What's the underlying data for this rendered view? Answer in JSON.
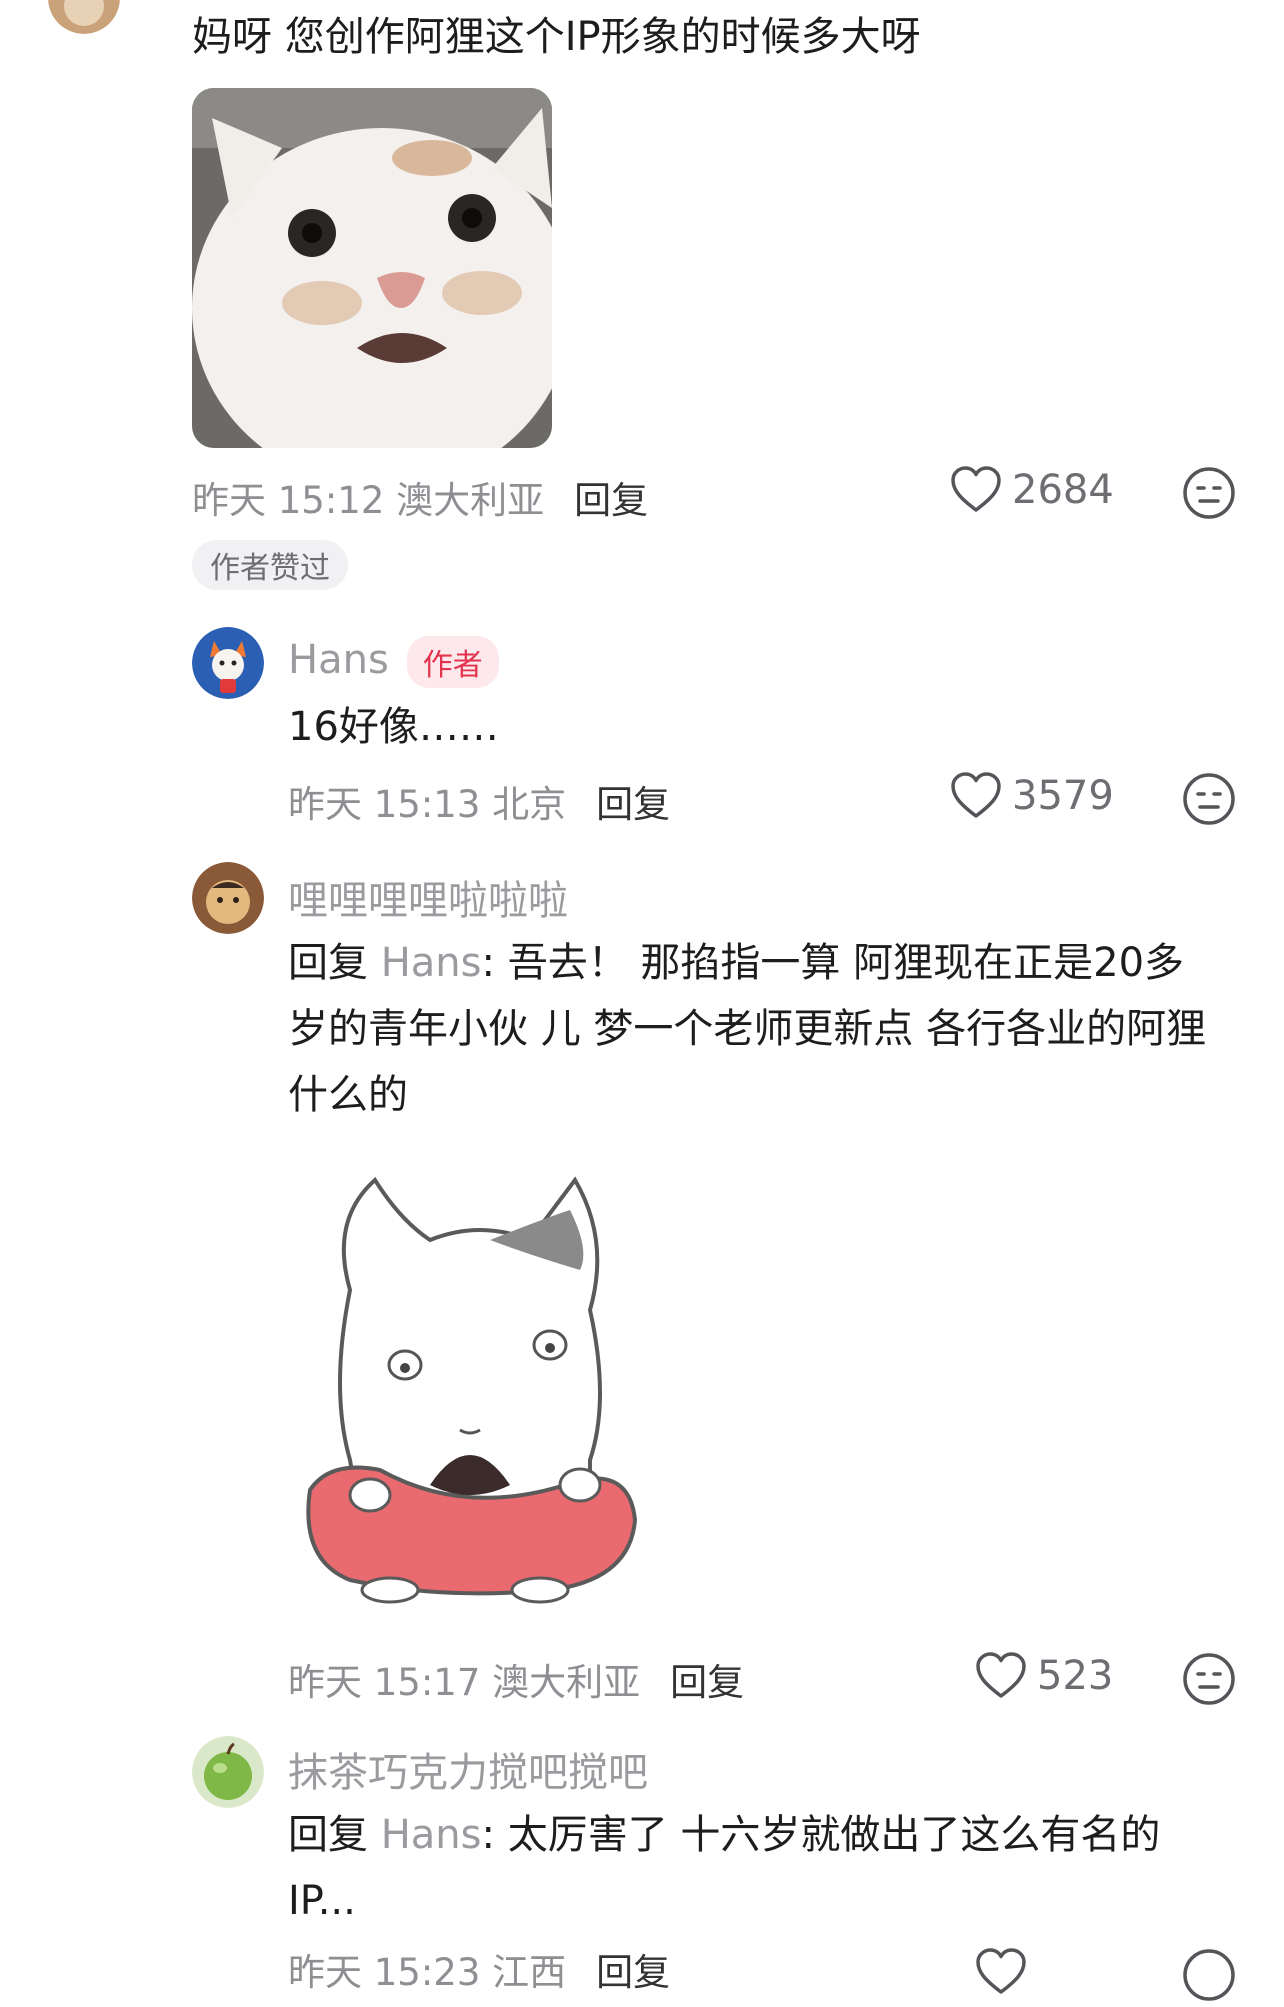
{
  "comments": [
    {
      "text": "妈呀  您创作阿狸这个IP形象的时候多大呀",
      "time": "昨天 15:12 澳大利亚",
      "reply_label": "回复",
      "likes": "2684",
      "badge": "作者赞过"
    },
    {
      "name": "Hans",
      "author_tag": "作者",
      "text": "16好像……",
      "time": "昨天 15:13 北京",
      "reply_label": "回复",
      "likes": "3579"
    },
    {
      "name": "哩哩哩哩啦啦啦",
      "reply_prefix": "回复",
      "mention": "Hans",
      "text_line1": ": 吾去！  那掐指一算 阿狸现在正是20多",
      "text_line2": "岁的青年小伙 儿 梦一个老师更新点 各行各业的阿狸",
      "text_line3": "什么的",
      "time": "昨天 15:17 澳大利亚",
      "reply_label": "回复",
      "likes": "523"
    },
    {
      "name": "抹茶巧克力搅吧搅吧",
      "reply_prefix": "回复",
      "mention": "Hans",
      "text_line1": ": 太厉害了 十六岁就做出了这么有名的",
      "text_line2": "IP...",
      "time": "昨天 15:23 江西",
      "reply_label": "回复"
    }
  ],
  "icons": {
    "like": "heart-outline-icon",
    "dislike": "neutral-face-icon"
  },
  "colors": {
    "author_tag": "#e3344f",
    "secondary_text": "#8e8e93"
  }
}
